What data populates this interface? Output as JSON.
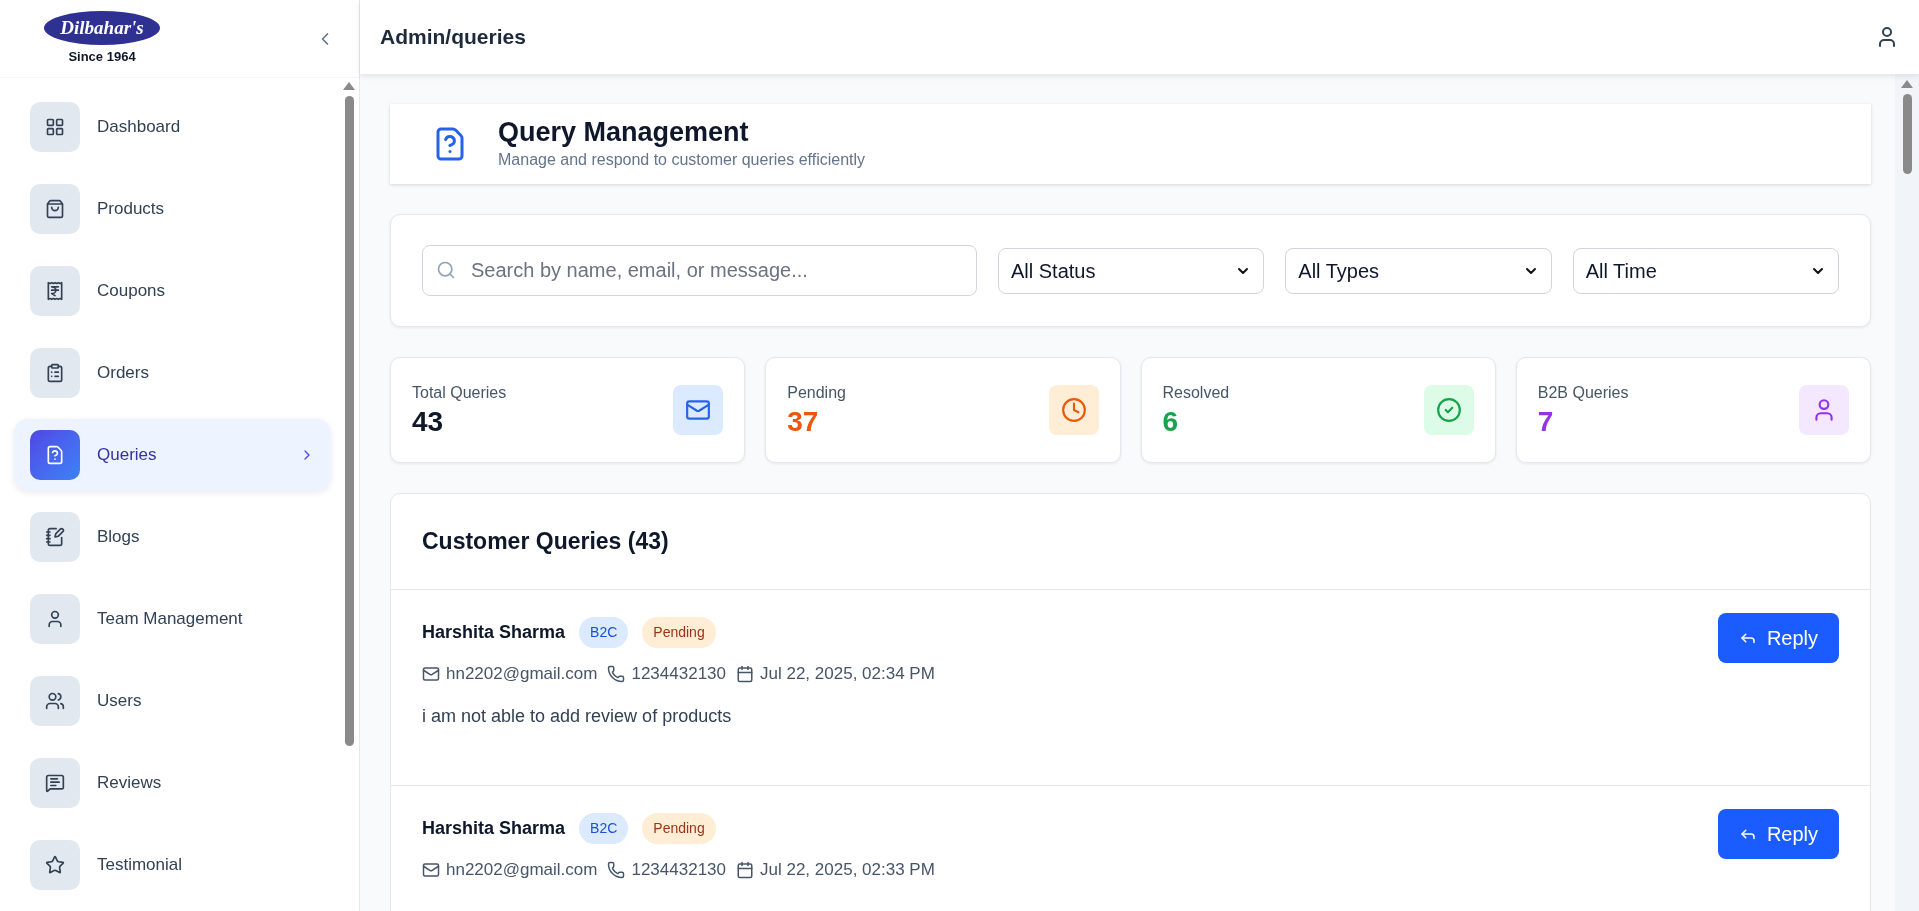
{
  "logo": {
    "name": "Dilbahar's",
    "tagline": "Since 1964"
  },
  "sidebar": {
    "items": [
      {
        "label": "Dashboard",
        "selected": false
      },
      {
        "label": "Products",
        "selected": false
      },
      {
        "label": "Coupons",
        "selected": false
      },
      {
        "label": "Orders",
        "selected": false
      },
      {
        "label": "Queries",
        "selected": true
      },
      {
        "label": "Blogs",
        "selected": false
      },
      {
        "label": "Team Management",
        "selected": false
      },
      {
        "label": "Users",
        "selected": false
      },
      {
        "label": "Reviews",
        "selected": false
      },
      {
        "label": "Testimonial",
        "selected": false
      }
    ]
  },
  "header": {
    "breadcrumb": "Admin/queries"
  },
  "page": {
    "title": "Query Management",
    "subtitle": "Manage and respond to customer queries efficiently"
  },
  "filters": {
    "search": {
      "placeholder": "Search by name, email, or message..."
    },
    "dropdowns": [
      "All Status",
      "All Types",
      "All Time"
    ]
  },
  "stats": [
    {
      "label": "Total Queries",
      "value": "43",
      "color": "#0f172a"
    },
    {
      "label": "Pending",
      "value": "37",
      "color": "#ea580c"
    },
    {
      "label": "Resolved",
      "value": "6",
      "color": "#16a34a"
    },
    {
      "label": "B2B Queries",
      "value": "7",
      "color": "#9333ea"
    }
  ],
  "queries": {
    "title": "Customer Queries (43)",
    "items": [
      {
        "name": "Harshita Sharma",
        "badges": [
          {
            "text": "B2C",
            "color": "#1d4ed8"
          },
          {
            "text": "Pending",
            "color": "#9a3412"
          }
        ],
        "email": "hn2202@gmail.com",
        "phone": "1234432130",
        "date": "Jul 22, 2025, 02:34 PM",
        "message": "i am not able to add review of products",
        "action": "Reply"
      },
      {
        "name": "Harshita Sharma",
        "badges": [
          {
            "text": "B2C",
            "color": "#1d4ed8"
          },
          {
            "text": "Pending",
            "color": "#9a3412"
          }
        ],
        "email": "hn2202@gmail.com",
        "phone": "1234432130",
        "date": "Jul 22, 2025, 02:33 PM",
        "action": "Reply"
      }
    ]
  }
}
